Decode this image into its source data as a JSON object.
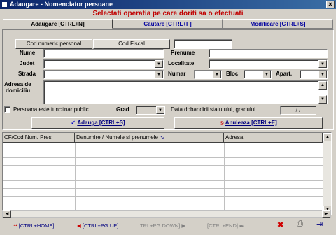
{
  "window": {
    "title": "Adaugare - Nomenclator persoane"
  },
  "heading": "Selectati operatia pe care doriti sa o efectuati",
  "tabs": [
    {
      "label": "Adaugare [CTRL+N]"
    },
    {
      "label": "Cautare [CTRL+F]"
    },
    {
      "label": "Modificare [CTRL+S]"
    }
  ],
  "form": {
    "btn_cnp": "Cod numeric personal",
    "btn_cf": "Cod Fiscal",
    "lbl_nume": "Nume",
    "lbl_prenume": "Prenume",
    "lbl_judet": "Judet",
    "lbl_localitate": "Localitate",
    "lbl_strada": "Strada",
    "lbl_numar": "Numar",
    "lbl_bloc": "Bloc",
    "lbl_apart": "Apart.",
    "lbl_adresa_1": "Adresa de",
    "lbl_adresa_2": "domiciliu",
    "chk_functionar": "Persoana este functinar public",
    "lbl_grad": "Grad",
    "lbl_data": "Data dobandirii statutului, gradului",
    "date_value": "/ /",
    "btn_add": "Adauga [CTRL+S]",
    "btn_cancel": "Anuleaza [CTRL+E]"
  },
  "grid": {
    "columns": [
      "CF/Cod Num. Pres",
      "Denumire / Numele si prenumele",
      "Adresa"
    ]
  },
  "nav": {
    "home": "[CTRL+HOME]",
    "pgup": "[CTRL+PG.UP]",
    "pgdown": "TRL+PG.DOWN]",
    "end": "[CTRL+END]"
  }
}
